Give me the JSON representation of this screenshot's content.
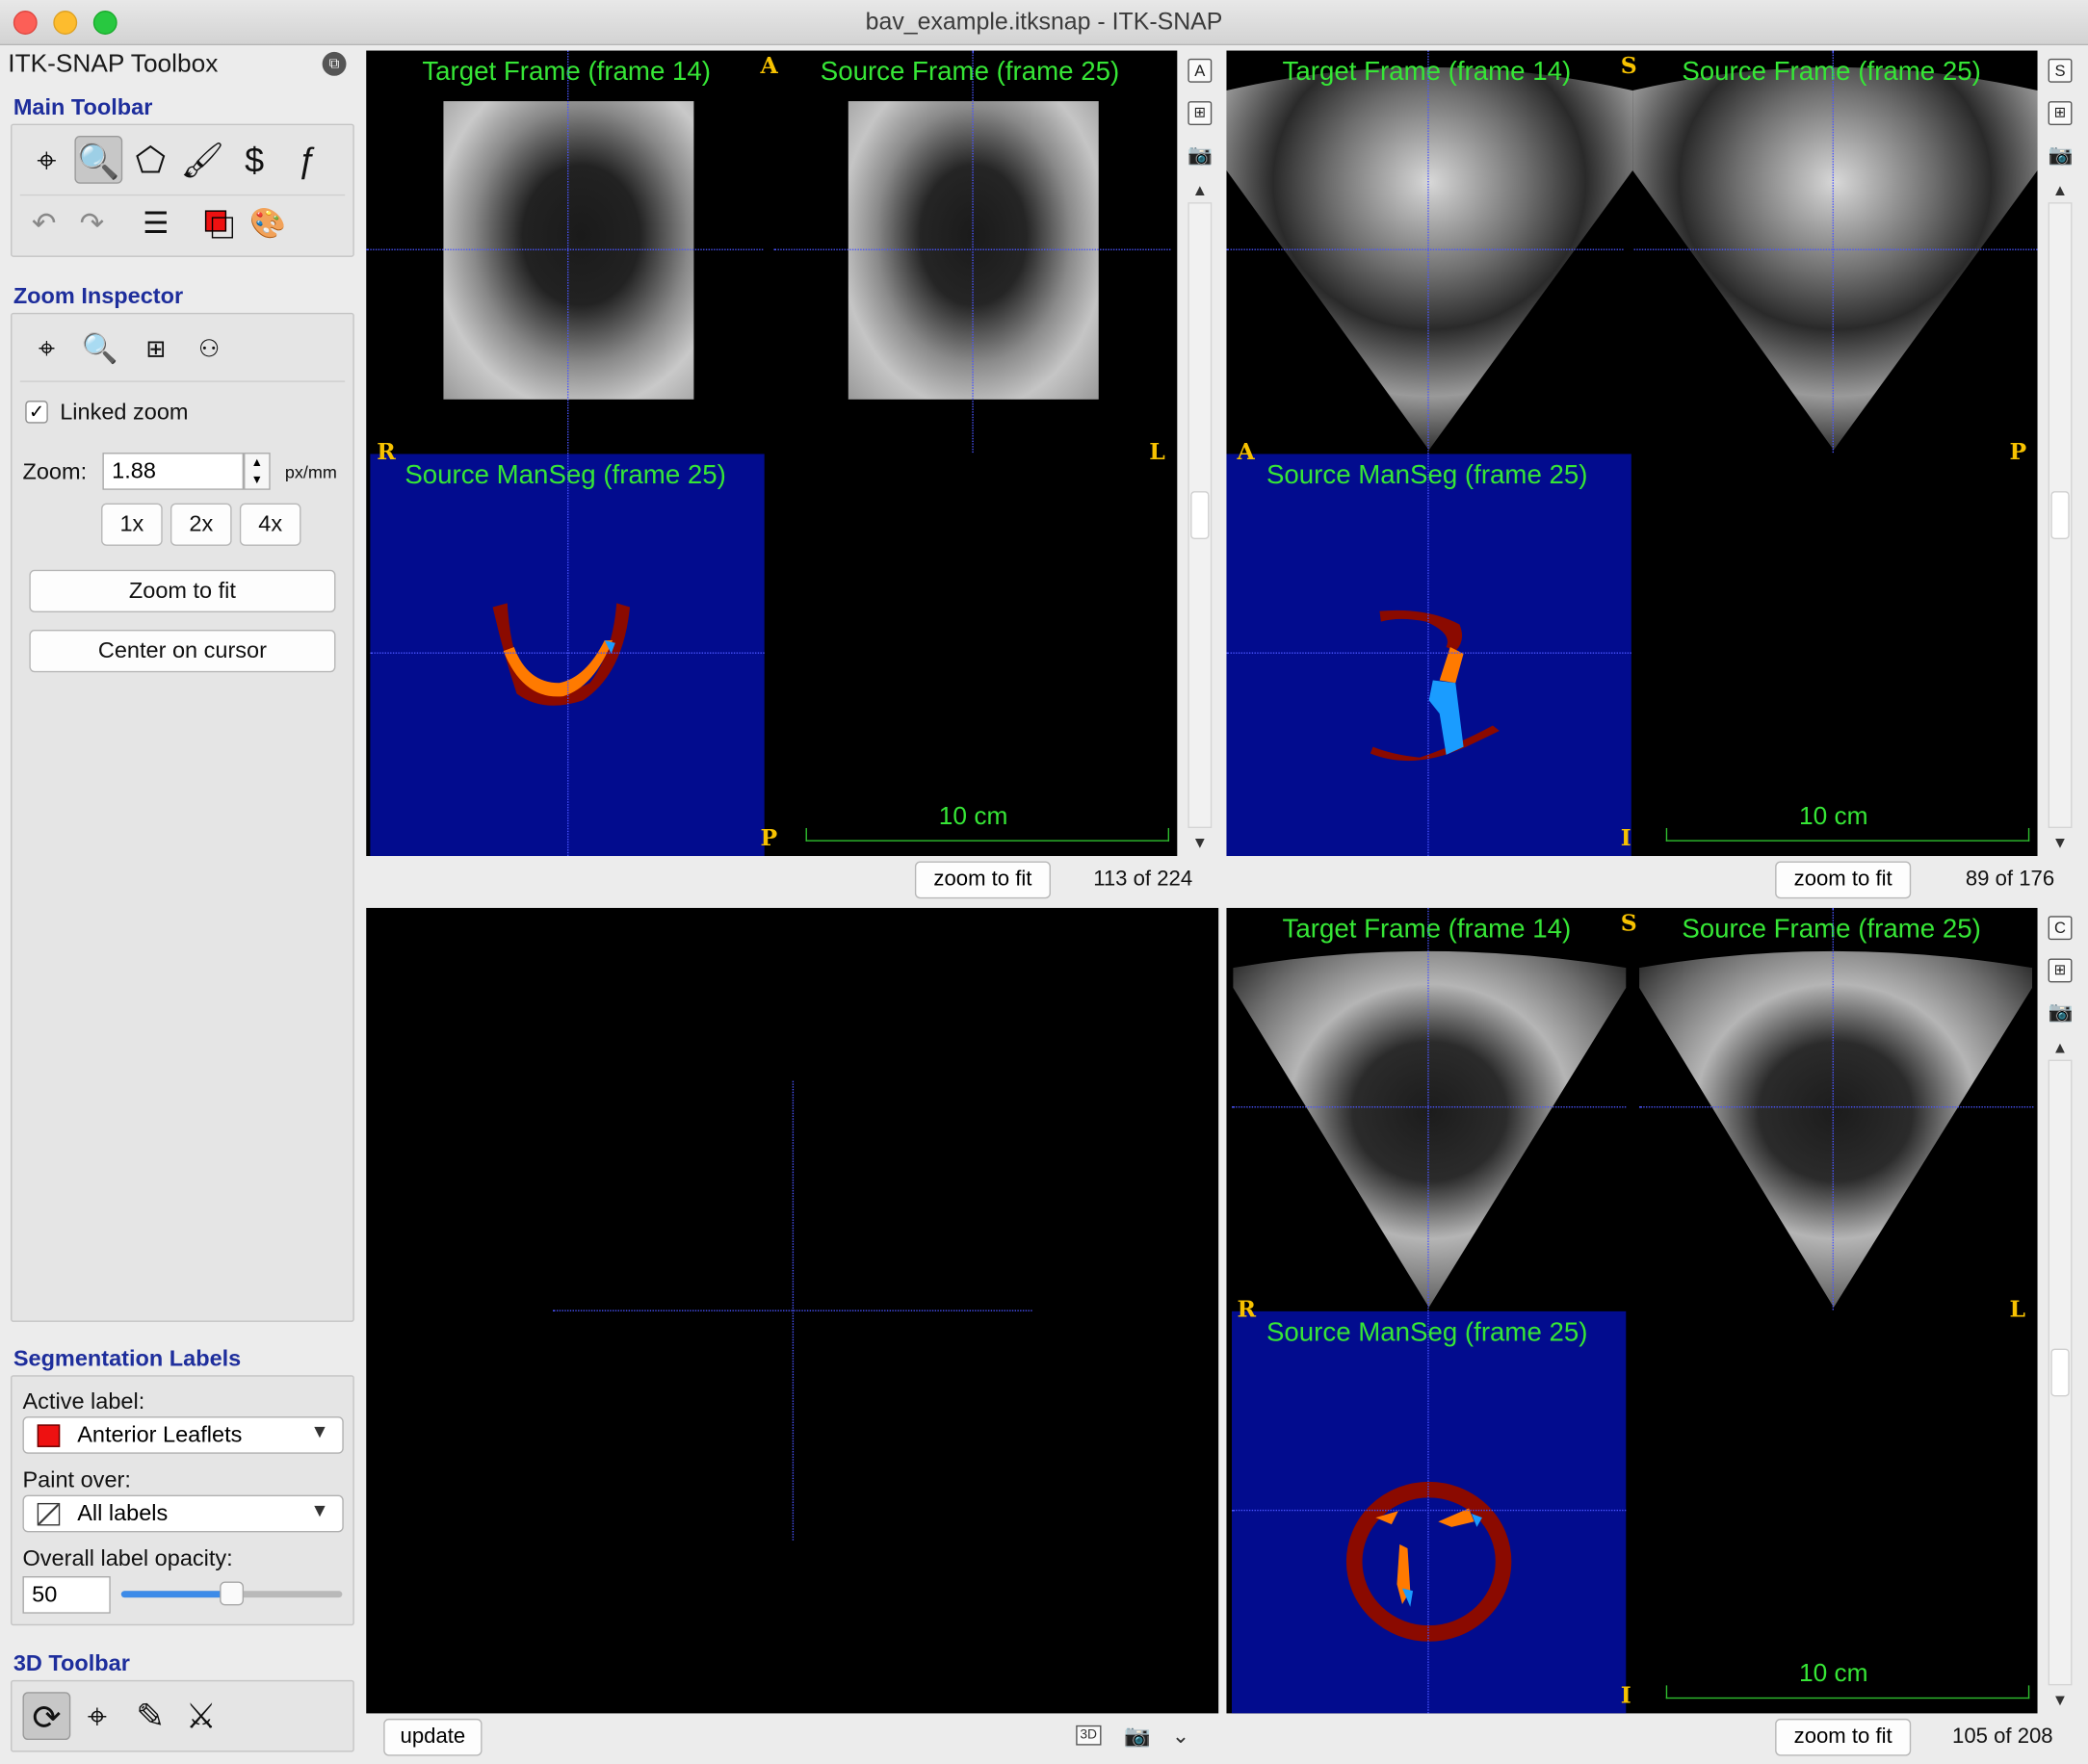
{
  "window": {
    "title": "bav_example.itksnap - ITK-SNAP"
  },
  "toolbox": {
    "title": "ITK-SNAP Toolbox",
    "main_toolbar": {
      "title": "Main Toolbar",
      "tools": [
        "crosshair-tool",
        "zoom-tool",
        "polygon-tool",
        "paintbrush-tool",
        "snake-tool",
        "annotation-tool"
      ],
      "actions": [
        "undo",
        "redo",
        "layers",
        "label-color",
        "palette"
      ]
    },
    "zoom_inspector": {
      "title": "Zoom Inspector",
      "linked_zoom_label": "Linked zoom",
      "linked_zoom_checked": "✓",
      "zoom_label": "Zoom:",
      "zoom_value": "1.88",
      "zoom_unit": "px/mm",
      "preset_1x": "1x",
      "preset_2x": "2x",
      "preset_4x": "4x",
      "zoom_to_fit": "Zoom to fit",
      "center_on_cursor": "Center on cursor"
    },
    "segmentation_labels": {
      "title": "Segmentation Labels",
      "active_label_caption": "Active label:",
      "active_label": "Anterior Leaflets",
      "active_label_color": "#ee1111",
      "paint_over_caption": "Paint over:",
      "paint_over": "All labels",
      "opacity_caption": "Overall label opacity:",
      "opacity_value": "50",
      "opacity_level": 0.5
    },
    "toolbar_3d": {
      "title": "3D Toolbar"
    }
  },
  "views": {
    "axial": {
      "target_title": "Target Frame (frame 14)",
      "source_title": "Source Frame (frame 25)",
      "seg_title": "Source ManSeg (frame 25)",
      "ori_top": "A",
      "ori_left": "R",
      "ori_right": "L",
      "ori_bottom": "P",
      "scale": "10 cm",
      "side_button": "A",
      "zoom_to_fit": "zoom to fit",
      "slice": "113 of 224"
    },
    "sagittal": {
      "target_title": "Target Frame (frame 14)",
      "source_title": "Source Frame (frame 25)",
      "seg_title": "Source ManSeg (frame 25)",
      "ori_top": "S",
      "ori_left": "A",
      "ori_right": "P",
      "ori_bottom": "I",
      "scale": "10 cm",
      "side_button": "S",
      "zoom_to_fit": "zoom to fit",
      "slice": "89 of 176"
    },
    "coronal": {
      "target_title": "Target Frame (frame 14)",
      "source_title": "Source Frame (frame 25)",
      "seg_title": "Source ManSeg (frame 25)",
      "ori_top": "S",
      "ori_left": "R",
      "ori_right": "L",
      "ori_bottom": "I",
      "scale": "10 cm",
      "side_button": "C",
      "zoom_to_fit": "zoom to fit",
      "slice": "105 of 208"
    },
    "three_d": {
      "update": "update"
    }
  },
  "colors": {
    "overlay_text": "#36e636",
    "orientation": "#f7c200",
    "seg_background": "#020c8e",
    "label_dark_red": "#8b0a00",
    "label_orange": "#ff7a00",
    "label_blue": "#1a9cff"
  }
}
